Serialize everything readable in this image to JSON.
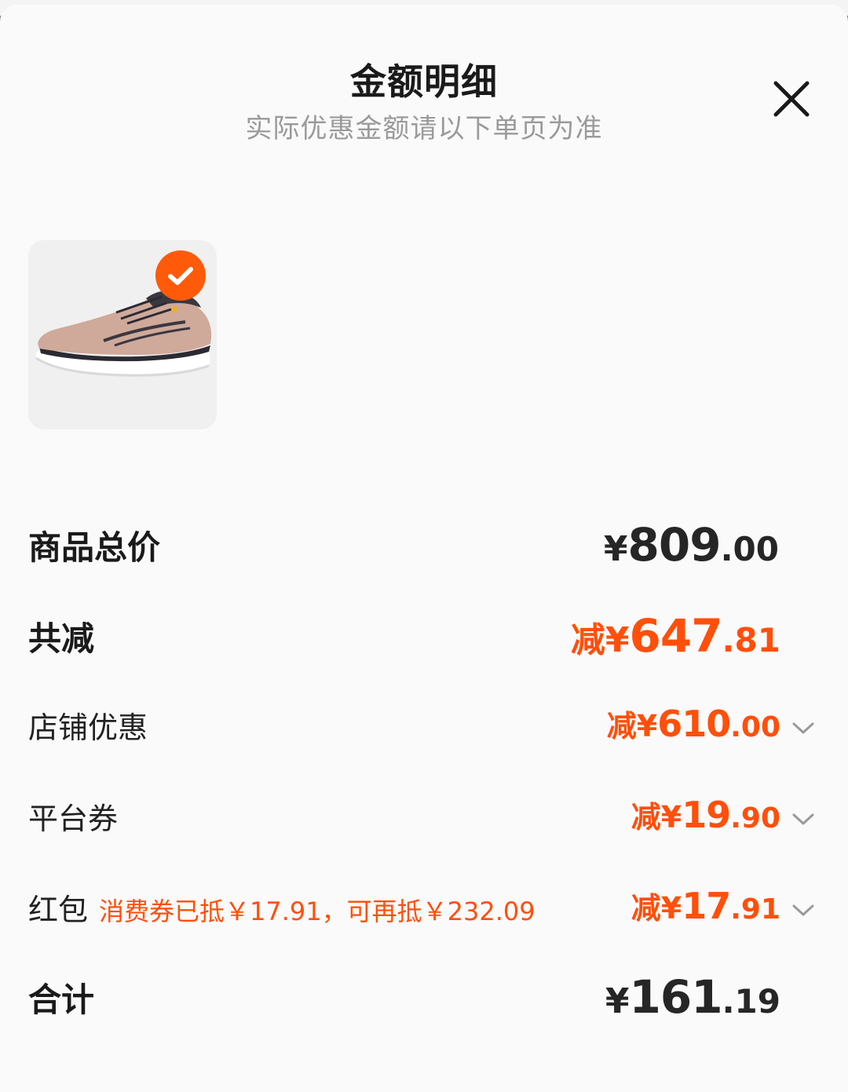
{
  "sheet": {
    "title": "金额明细",
    "subtitle": "实际优惠金额请以下单页为准",
    "close_icon": "close-icon"
  },
  "product": {
    "selected": true,
    "image_icon": "running-shoe-image",
    "badge_color": "#ff5a0a"
  },
  "rows": {
    "total_price": {
      "label": "商品总价",
      "prefix": "¥",
      "int": "809",
      "dec": ".00"
    },
    "total_discount": {
      "label": "共减",
      "prefix": "减¥",
      "int": "647",
      "dec": ".81"
    },
    "shop_discount": {
      "label": "店铺优惠",
      "prefix": "减¥",
      "int": "610",
      "dec": ".00"
    },
    "platform_coupon": {
      "label": "平台券",
      "prefix": "减¥",
      "int": "19",
      "dec": ".90"
    },
    "red_packet": {
      "label": "红包",
      "note": "消费券已抵￥17.91，可再抵￥232.09",
      "prefix": "减¥",
      "int": "17",
      "dec": ".91"
    },
    "grand_total": {
      "label": "合计",
      "prefix": "¥",
      "int": "161",
      "dec": ".19"
    }
  },
  "colors": {
    "accent": "#ff4f0a",
    "text": "#1a1a1a",
    "muted": "#9a9a9a"
  }
}
